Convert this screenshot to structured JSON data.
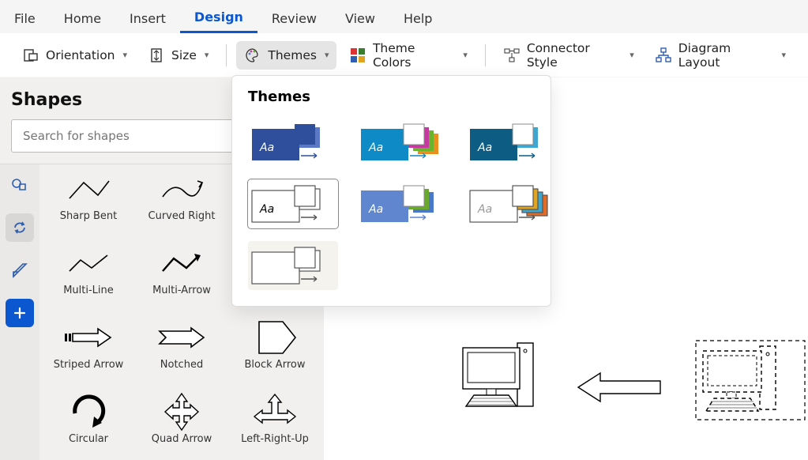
{
  "menu": {
    "items": [
      "File",
      "Home",
      "Insert",
      "Design",
      "Review",
      "View",
      "Help"
    ],
    "active": "Design"
  },
  "ribbon": {
    "orientation": "Orientation",
    "size": "Size",
    "themes": "Themes",
    "theme_colors": "Theme Colors",
    "connector_style": "Connector Style",
    "diagram_layout": "Diagram Layout"
  },
  "shapes_panel": {
    "title": "Shapes",
    "search_placeholder": "Search for shapes",
    "shapes": [
      {
        "id": "sharp-bent",
        "label": "Sharp Bent"
      },
      {
        "id": "curved-right",
        "label": "Curved Right"
      },
      {
        "id": "hidden",
        "label": ""
      },
      {
        "id": "multi-line",
        "label": "Multi-Line"
      },
      {
        "id": "multi-arrow",
        "label": "Multi-Arrow"
      },
      {
        "id": "hidden2",
        "label": ""
      },
      {
        "id": "striped",
        "label": "Striped Arrow"
      },
      {
        "id": "notched",
        "label": "Notched"
      },
      {
        "id": "block-arrow",
        "label": "Block Arrow"
      },
      {
        "id": "circular",
        "label": "Circular"
      },
      {
        "id": "quad-arrow",
        "label": "Quad Arrow"
      },
      {
        "id": "left-right-up",
        "label": "Left-Right-Up"
      }
    ]
  },
  "themes_popup": {
    "heading": "Themes",
    "themes": [
      {
        "id": "theme-blue-classic",
        "colors": [
          "#2f4e9b",
          "#5b78c7"
        ],
        "accent": "#2f4e9b",
        "aa": true,
        "aa_color": "#fff"
      },
      {
        "id": "theme-cyan-accent",
        "colors": [
          "#ffffff",
          "#c53aa0",
          "#69b42a",
          "#e98f1f"
        ],
        "accent": "#0e8ac6",
        "aa": true,
        "aa_color": "#fff"
      },
      {
        "id": "theme-deep-blue",
        "colors": [
          "#ffffff",
          "#3ea6cf"
        ],
        "accent": "#0d5c84",
        "aa": true,
        "aa_color": "#fff"
      },
      {
        "id": "theme-white-outline",
        "colors": [
          "#ffffff",
          "#ffffff"
        ],
        "accent": "#ffffff",
        "aa": true,
        "aa_color": "#000",
        "selected": true,
        "outline": true
      },
      {
        "id": "theme-soft-blue",
        "colors": [
          "#ffffff",
          "#6aa72f",
          "#4a79c9"
        ],
        "accent": "#5f86cf",
        "aa": true,
        "aa_color": "#fff"
      },
      {
        "id": "theme-light-gray",
        "colors": [
          "#ffffff",
          "#e0a41f",
          "#3ea6cf",
          "#e56b25"
        ],
        "accent": "#ffffff",
        "aa": true,
        "aa_color": "#999",
        "outline": true
      },
      {
        "id": "theme-minimal-white",
        "colors": [
          "#ffffff",
          "#ffffff"
        ],
        "accent": "#ffffff",
        "aa": false,
        "minimal": true,
        "outline": true
      }
    ]
  }
}
